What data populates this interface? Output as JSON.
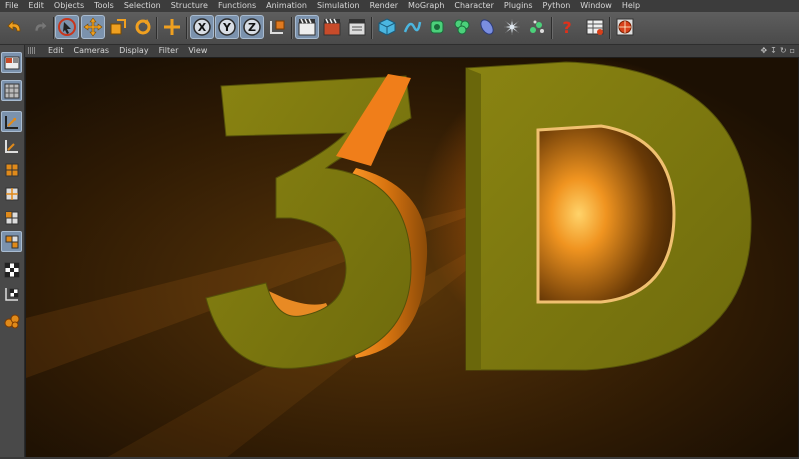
{
  "menubar": {
    "items": [
      "File",
      "Edit",
      "Objects",
      "Tools",
      "Selection",
      "Structure",
      "Functions",
      "Animation",
      "Simulation",
      "Render",
      "MoGraph",
      "Character",
      "Plugins",
      "Python",
      "Window",
      "Help"
    ]
  },
  "toolbar": {
    "axis_x_label": "X",
    "axis_y_label": "Y",
    "axis_z_label": "Z",
    "help_label": "?"
  },
  "viewport": {
    "menu": [
      "Edit",
      "Cameras",
      "Display",
      "Filter",
      "View"
    ],
    "scene_text": "3D"
  },
  "colors": {
    "accent": "#7b92ad",
    "highlight_orange": "#e58a1a",
    "text_olive": "#7d7a10"
  }
}
